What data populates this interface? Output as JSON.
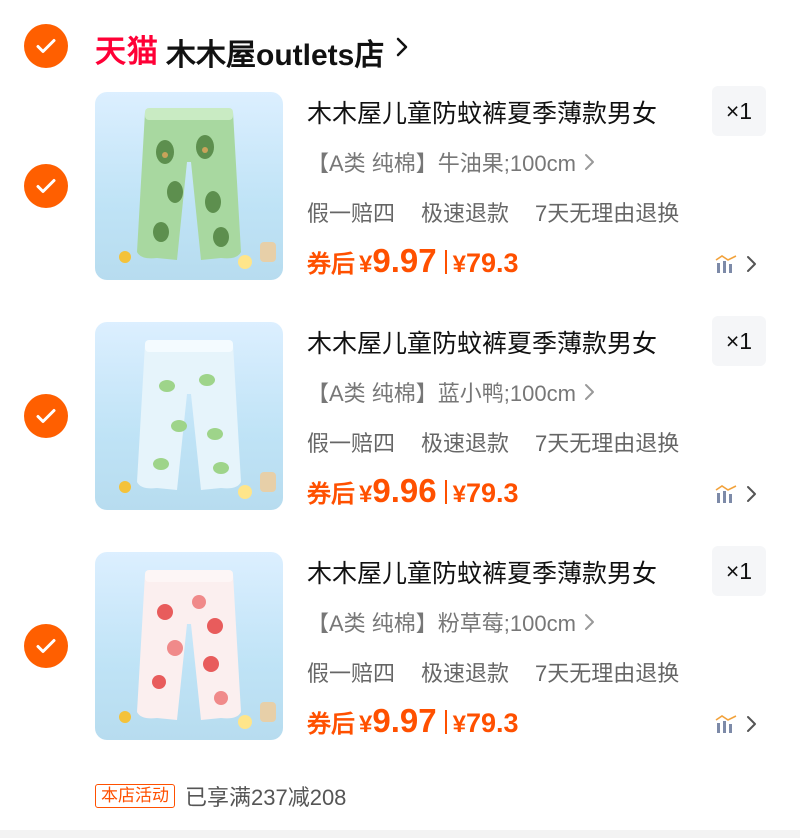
{
  "shop": {
    "brand": "天猫",
    "name": "木木屋outlets店",
    "selected": true
  },
  "items": [
    {
      "title": "木木屋儿童防蚊裤夏季薄款男女",
      "quantity": "×1",
      "sku": "【A类 纯棉】牛油果;100cm",
      "services": [
        "假一赔四",
        "极速退款",
        "7天无理由退换"
      ],
      "price_label": "券后",
      "currency": "¥",
      "price": "9.97",
      "original_price": "79.3",
      "image_theme": "avocado-print",
      "selected": true
    },
    {
      "title": "木木屋儿童防蚊裤夏季薄款男女",
      "quantity": "×1",
      "sku": "【A类 纯棉】蓝小鸭;100cm",
      "services": [
        "假一赔四",
        "极速退款",
        "7天无理由退换"
      ],
      "price_label": "券后",
      "currency": "¥",
      "price": "9.96",
      "original_price": "79.3",
      "image_theme": "duck-print",
      "selected": true
    },
    {
      "title": "木木屋儿童防蚊裤夏季薄款男女",
      "quantity": "×1",
      "sku": "【A类 纯棉】粉草莓;100cm",
      "services": [
        "假一赔四",
        "极速退款",
        "7天无理由退换"
      ],
      "price_label": "券后",
      "currency": "¥",
      "price": "9.97",
      "original_price": "79.3",
      "image_theme": "strawberry-print",
      "selected": true
    }
  ],
  "promo": {
    "badge": "本店活动",
    "text": "已享满237减208"
  },
  "colors": {
    "accent": "#ff5000",
    "check": "#ff5f00",
    "tmall": "#ff0036"
  }
}
